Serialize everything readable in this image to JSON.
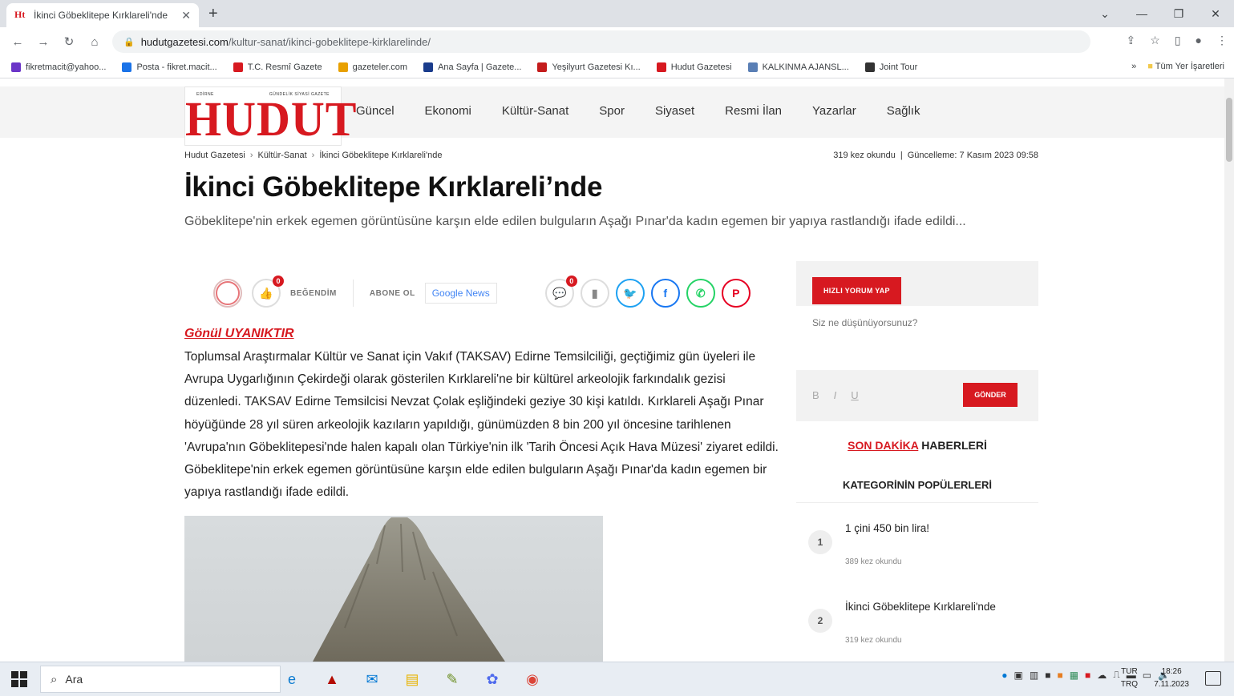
{
  "browser": {
    "tab_title": "İkinci Göbeklitepe Kırklareli'nde",
    "url_host": "hudutgazetesi.com",
    "url_path": "/kultur-sanat/ikinci-gobeklitepe-kirklarelinde/",
    "bookmarks": [
      {
        "label": "fikretmacit@yahoo...",
        "color": "#6b35c8"
      },
      {
        "label": "Posta - fikret.macit...",
        "color": "#1a73e8"
      },
      {
        "label": "T.C. Resmî Gazete",
        "color": "#d71920"
      },
      {
        "label": "gazeteler.com",
        "color": "#e8a000"
      },
      {
        "label": "Ana Sayfa | Gazete...",
        "color": "#1a3c8c"
      },
      {
        "label": "Yeşilyurt Gazetesi Kı...",
        "color": "#c41c1c"
      },
      {
        "label": "Hudut Gazetesi",
        "color": "#d71920"
      },
      {
        "label": "KALKINMA AJANSL...",
        "color": "#5a7fb5"
      },
      {
        "label": "Joint Tour",
        "color": "#333333"
      }
    ],
    "all_bookmarks": "Tüm Yer İşaretleri"
  },
  "site": {
    "logo_small_left": "EDİRNE",
    "logo_small_right": "GÜNDELİK SİYASİ GAZETE",
    "logo": "HUDUT",
    "nav": [
      "Güncel",
      "Ekonomi",
      "Kültür-Sanat",
      "Spor",
      "Siyaset",
      "Resmi İlan",
      "Yazarlar",
      "Sağlık"
    ]
  },
  "article": {
    "breadcrumb": [
      "Hudut Gazetesi",
      "Kültür-Sanat",
      "İkinci Göbeklitepe Kırklareli'nde"
    ],
    "reads": "319 kez okundu",
    "updated": "Güncelleme: 7 Kasım 2023 09:58",
    "title": "İkinci Göbeklitepe Kırklareli’nde",
    "summary": "Göbeklitepe'nin erkek egemen görüntüsüne karşın elde edilen bulguların Aşağı Pınar'da kadın egemen bir yapıya rastlandığı ifade edildi...",
    "like_count": "0",
    "like_label": "BEĞENDİM",
    "subscribe_label": "ABONE OL",
    "gnews_label": "Google News",
    "comment_count": "0",
    "author": "Gönül UYANIKTIR",
    "body": "Toplumsal Araştırmalar Kültür ve Sanat için Vakıf (TAKSAV) Edirne Temsilciliği, geçtiğimiz gün üyeleri ile Avrupa Uygarlığının Çekirdeği olarak gösterilen Kırklareli'ne bir kültürel arkeolojik farkındalık gezisi düzenledi. TAKSAV Edirne Temsilcisi Nevzat Çolak eşliğindeki geziye 30 kişi katıldı. Kırklareli Aşağı Pınar höyüğünde 28 yıl süren arkeolojik kazıların yapıldığı, günümüzden 8 bin 200 yıl öncesine tarihlenen 'Avrupa'nın Göbeklitepesi'nde halen kapalı olan Türkiye'nin ilk 'Tarih Öncesi Açık Hava Müzesi' ziyaret edildi. Göbeklitepe'nin erkek egemen görüntüsüne karşın elde edilen bulguların Aşağı Pınar'da kadın egemen bir yapıya rastlandığı ifade edildi."
  },
  "sidebar": {
    "comment_tag": "HIZLI YORUM YAP",
    "comment_placeholder": "Siz ne düşünüyorsunuz?",
    "bold": "B",
    "italic": "I",
    "underline": "U",
    "send": "GÖNDER",
    "sondakika_red": "SON DAKİKA",
    "sondakika_rest": "HABERLERİ",
    "popular_title": "KATEGORİNİN POPÜLERLERİ",
    "popular": [
      {
        "num": "1",
        "title": "1 çini 450 bin lira!",
        "reads": "389 kez okundu"
      },
      {
        "num": "2",
        "title": "İkinci Göbeklitepe Kırklareli'nde",
        "reads": "319 kez okundu"
      }
    ]
  },
  "taskbar": {
    "search": "Ara",
    "lang_top": "TUR",
    "lang_bottom": "TRQ",
    "time": "18:26",
    "date": "7.11.2023"
  }
}
